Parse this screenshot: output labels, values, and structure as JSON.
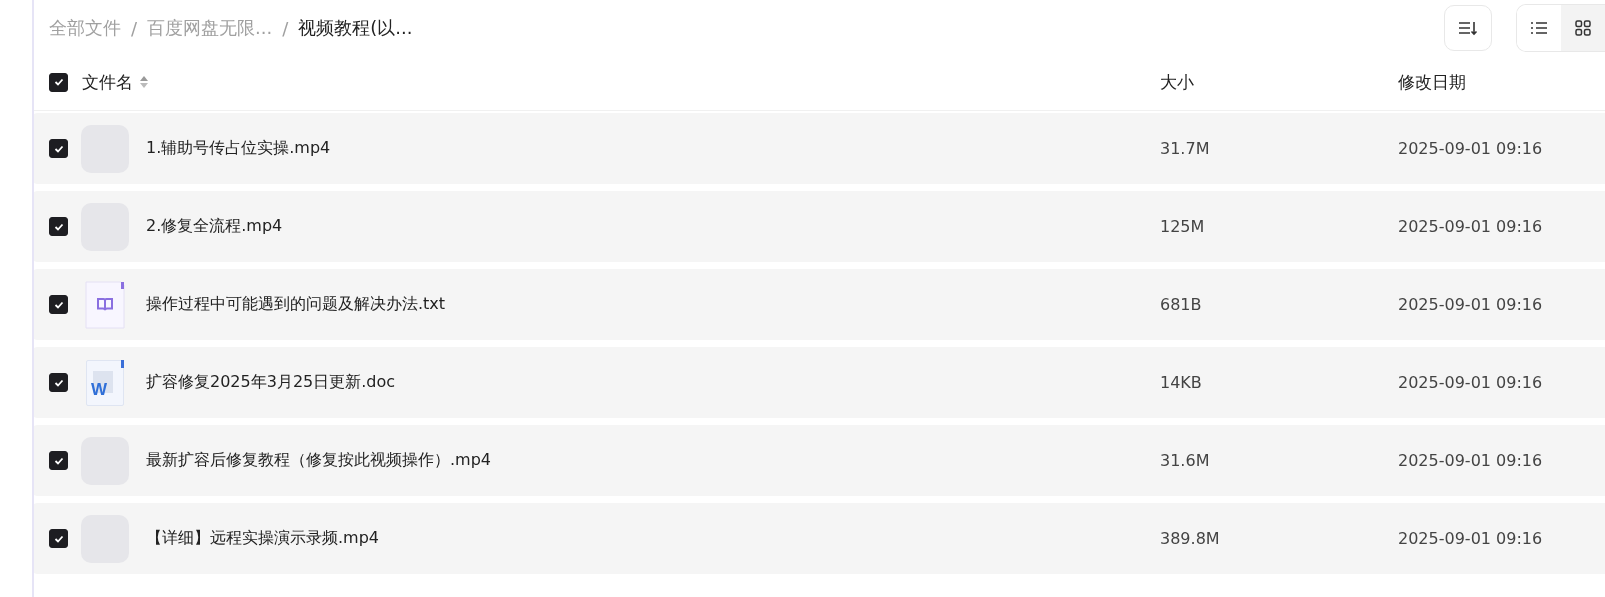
{
  "breadcrumb": [
    {
      "label": "全部文件",
      "current": false
    },
    {
      "label": "百度网盘无限...",
      "current": false
    },
    {
      "label": "视频教程(以...",
      "current": true
    }
  ],
  "separator": "/",
  "view_modes": [
    {
      "kind": "list",
      "selected": false
    },
    {
      "kind": "grid",
      "selected": true
    }
  ],
  "header": {
    "all_checked": true,
    "columns": [
      "文件名",
      "大小",
      "修改日期"
    ]
  },
  "files": [
    {
      "name": "1.辅助号传占位实操.mp4",
      "kind": "video",
      "size": "31.7M",
      "modified": "2025-09-01 09:16",
      "checked": true
    },
    {
      "name": "2.修复全流程.mp4",
      "kind": "video",
      "size": "125M",
      "modified": "2025-09-01 09:16",
      "checked": true
    },
    {
      "name": "操作过程中可能遇到的问题及解决办法.txt",
      "kind": "text",
      "size": "681B",
      "modified": "2025-09-01 09:16",
      "checked": true
    },
    {
      "name": "扩容修复2025年3月25日更新.doc",
      "kind": "doc",
      "icon_letter": "W",
      "size": "14KB",
      "modified": "2025-09-01 09:16",
      "checked": true
    },
    {
      "name": "最新扩容后修复教程（修复按此视频操作）.mp4",
      "kind": "video",
      "size": "31.6M",
      "modified": "2025-09-01 09:16",
      "checked": true
    },
    {
      "name": "【详细】远程实操演示录频.mp4",
      "kind": "video",
      "size": "389.8M",
      "modified": "2025-09-01 09:16",
      "checked": true
    }
  ]
}
